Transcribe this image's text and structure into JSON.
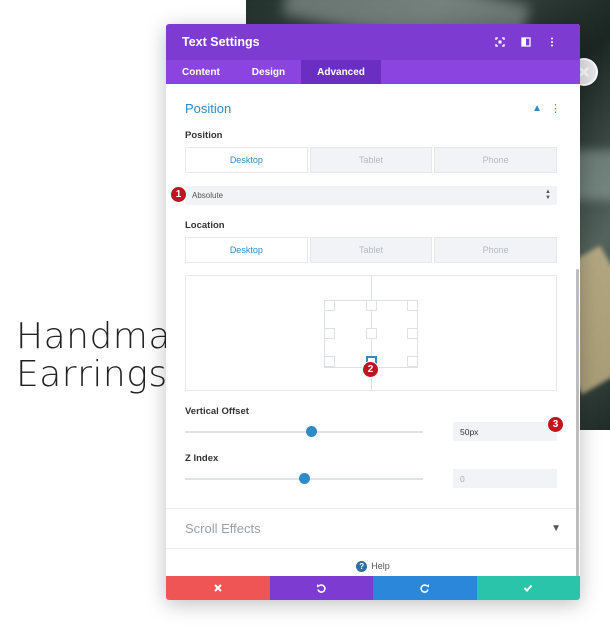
{
  "background": {
    "heading_line1": "Handma",
    "heading_line2": "Earrings"
  },
  "modal": {
    "title": "Text Settings",
    "header_icons": [
      "expand-icon",
      "split-view-icon",
      "more-icon"
    ],
    "tabs": [
      {
        "label": "Content",
        "active": false
      },
      {
        "label": "Design",
        "active": false
      },
      {
        "label": "Advanced",
        "active": true
      }
    ]
  },
  "position_section": {
    "title": "Position",
    "position_label": "Position",
    "position_devices": [
      "Desktop",
      "Tablet",
      "Phone"
    ],
    "position_value": "Absolute",
    "location_label": "Location",
    "location_devices": [
      "Desktop",
      "Tablet",
      "Phone"
    ],
    "vertical_offset_label": "Vertical Offset",
    "vertical_offset_value": "50px",
    "vertical_offset_fraction": 0.53,
    "z_index_label": "Z Index",
    "z_index_value": "0",
    "z_index_fraction": 0.5
  },
  "scroll_section": {
    "title": "Scroll Effects"
  },
  "help_label": "Help",
  "annotations": {
    "step1": "1",
    "step2": "2",
    "step3": "3"
  },
  "colors": {
    "header": "#7d3bd2",
    "tabs": "#8b44e0",
    "accent": "#2e8bc6",
    "cancel": "#ef5555",
    "undo": "#7d3bd2",
    "redo": "#2b87da",
    "save": "#29c4a9",
    "badge": "#c0141f"
  },
  "footer_buttons": [
    "close-icon",
    "undo-icon",
    "redo-icon",
    "check-icon"
  ]
}
